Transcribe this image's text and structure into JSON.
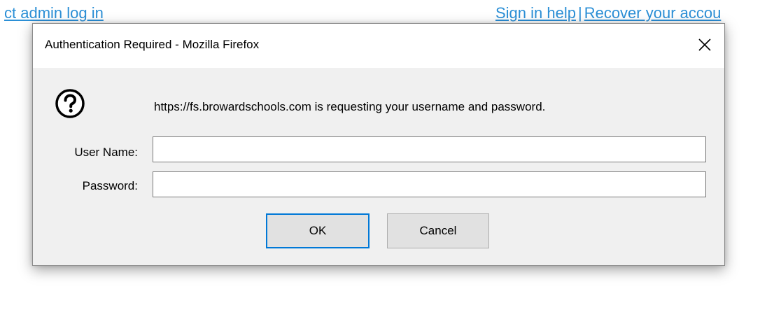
{
  "background": {
    "left_link": "ct admin log in",
    "sign_in_help": "Sign in help",
    "separator": "|",
    "recover_link": "Recover your accou"
  },
  "dialog": {
    "title": "Authentication Required - Mozilla Firefox",
    "close_glyph": "close-icon",
    "icon": "question-icon",
    "message": "https://fs.browardschools.com is requesting your username and password.",
    "username_label": "User Name:",
    "username_value": "",
    "password_label": "Password:",
    "password_value": "",
    "ok_label": "OK",
    "cancel_label": "Cancel"
  },
  "colors": {
    "link": "#2b8fd6",
    "dialog_bg": "#f0f0f0",
    "focus_border": "#0078d7",
    "button_bg": "#e1e1e1"
  }
}
